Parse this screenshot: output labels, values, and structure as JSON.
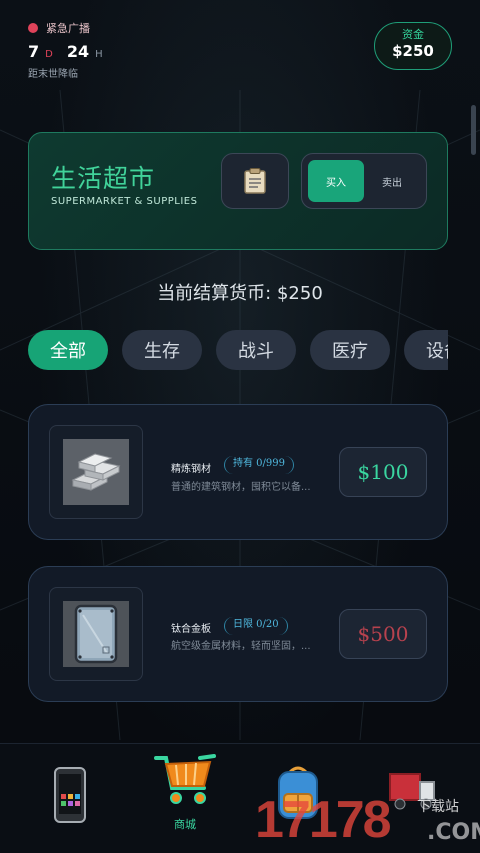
{
  "status": {
    "alert_label": "紧急广播",
    "days": "7",
    "days_unit": "D",
    "hours": "24",
    "hours_unit": "H",
    "subtitle": "距末世降临"
  },
  "fund": {
    "label": "资金",
    "value": "$250"
  },
  "store": {
    "title": "生活超市",
    "subtitle": "SUPERMARKET & SUPPLIES",
    "doc_icon": "clipboard-icon",
    "buy_label": "买入",
    "sell_label": "卖出",
    "active_mode": "buy"
  },
  "currency_text": "当前结算货币: $250",
  "tabs": [
    {
      "label": "全部",
      "active": true
    },
    {
      "label": "生存",
      "active": false
    },
    {
      "label": "战斗",
      "active": false
    },
    {
      "label": "医疗",
      "active": false
    },
    {
      "label": "设备",
      "active": false
    }
  ],
  "items": [
    {
      "name": "精炼钢材",
      "badge": "持有 0/999",
      "desc": "普通的建筑钢材，囤积它以备...",
      "price": "$100",
      "affordable": true,
      "icon": "steel-ingots-icon"
    },
    {
      "name": "钛合金板",
      "badge": "日限 0/20",
      "desc": "航空级金属材料，轻而坚固，...",
      "price": "$500",
      "affordable": false,
      "icon": "titanium-plate-icon"
    }
  ],
  "nav": {
    "phone_icon": "phone-icon",
    "shop_icon": "shopping-cart-icon",
    "shop_label": "商城",
    "backpack_icon": "backpack-icon",
    "truck_icon": "truck-icon"
  },
  "watermark": {
    "number": "17178",
    "download": "下载站",
    "domain": ".COM"
  },
  "colors": {
    "accent": "#17a476",
    "alert": "#e0435a",
    "price_ok": "#3ad6a0",
    "price_bad": "#b8424e"
  }
}
